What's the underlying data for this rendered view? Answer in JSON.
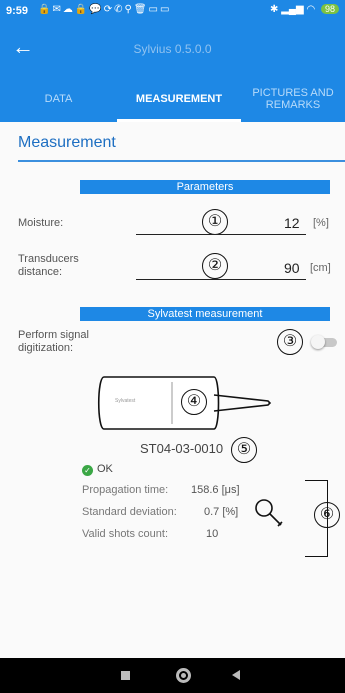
{
  "status_bar": {
    "time": "9:59",
    "icons": [
      "lock-icon",
      "mail-icon",
      "cloud-icon",
      "lock-icon",
      "chat-icon",
      "sync-icon",
      "phone-icon",
      "location-icon",
      "trash-icon",
      "screen-icon",
      "screen-icon"
    ],
    "battery": "98"
  },
  "app_bar": {
    "title": "Sylvius 0.5.0.0",
    "back_icon": "arrow-back-icon"
  },
  "tabs": [
    {
      "label": "DATA",
      "active": false
    },
    {
      "label": "MEASUREMENT",
      "active": true
    },
    {
      "label": "PICTURES AND REMARKS",
      "active": false
    }
  ],
  "section_title": "Measurement",
  "parameters": {
    "header": "Parameters",
    "moisture": {
      "label": "Moisture:",
      "value": "12",
      "unit": "[%]"
    },
    "distance": {
      "label": "Transducers distance:",
      "value": "90",
      "unit": "[cm]"
    }
  },
  "sylvatest": {
    "header": "Sylvatest measurement",
    "digitization_label": "Perform signal digitization:",
    "digitization_enabled": false,
    "probe_brand": "Sylvatest",
    "serial": "ST04-03-0010",
    "status": "OK",
    "results": [
      {
        "label": "Propagation time:",
        "value": "158.6 [μs]"
      },
      {
        "label": "Standard deviation:",
        "value": "0.7 [%]"
      },
      {
        "label": "Valid shots count:",
        "value": "10"
      }
    ]
  },
  "callouts": [
    "①",
    "②",
    "③",
    "④",
    "⑤",
    "⑥"
  ],
  "colors": {
    "primary": "#1e88e5",
    "accent": "#1e6fc2",
    "ok": "#3aa745"
  }
}
